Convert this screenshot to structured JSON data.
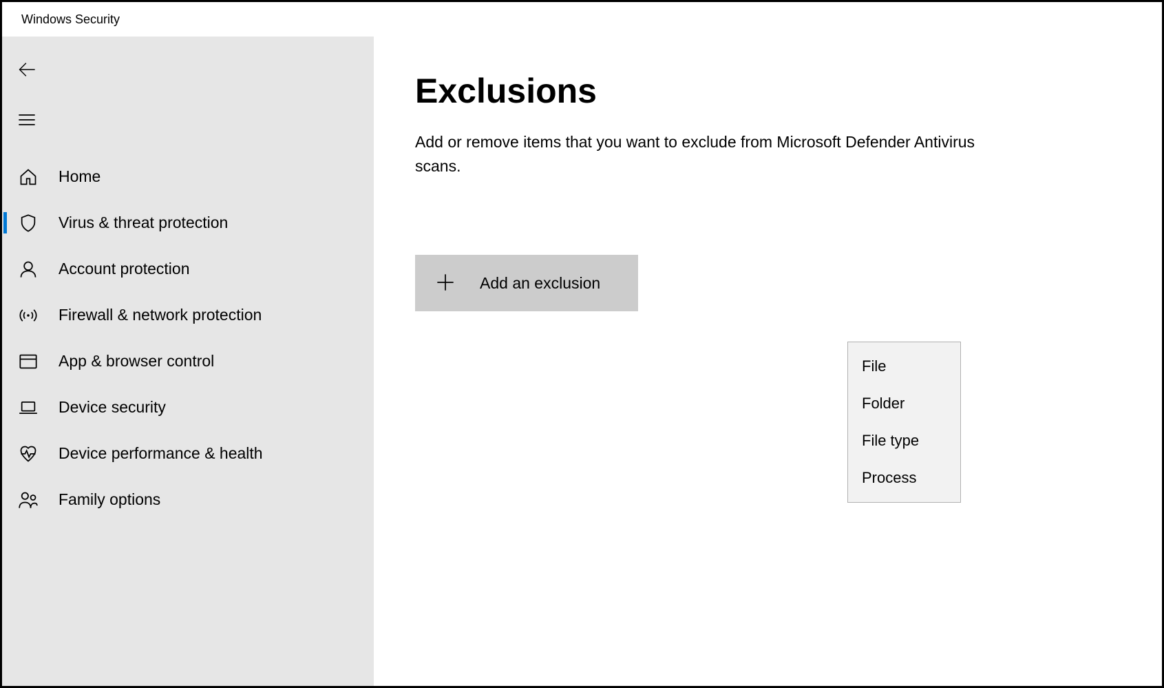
{
  "titlebar": {
    "title": "Windows Security"
  },
  "sidebar": {
    "items": [
      {
        "label": "Home",
        "icon": "home-icon",
        "active": false
      },
      {
        "label": "Virus & threat protection",
        "icon": "shield-icon",
        "active": true
      },
      {
        "label": "Account protection",
        "icon": "person-icon",
        "active": false
      },
      {
        "label": "Firewall & network protection",
        "icon": "antenna-icon",
        "active": false
      },
      {
        "label": "App & browser control",
        "icon": "window-icon",
        "active": false
      },
      {
        "label": "Device security",
        "icon": "laptop-icon",
        "active": false
      },
      {
        "label": "Device performance & health",
        "icon": "heart-icon",
        "active": false
      },
      {
        "label": "Family options",
        "icon": "family-icon",
        "active": false
      }
    ]
  },
  "main": {
    "title": "Exclusions",
    "subtitle": "Add or remove items that you want to exclude from Microsoft Defender Antivirus scans.",
    "add_button_label": "Add an exclusion",
    "dropdown_options": [
      {
        "label": "File"
      },
      {
        "label": "Folder"
      },
      {
        "label": "File type"
      },
      {
        "label": "Process"
      }
    ]
  }
}
